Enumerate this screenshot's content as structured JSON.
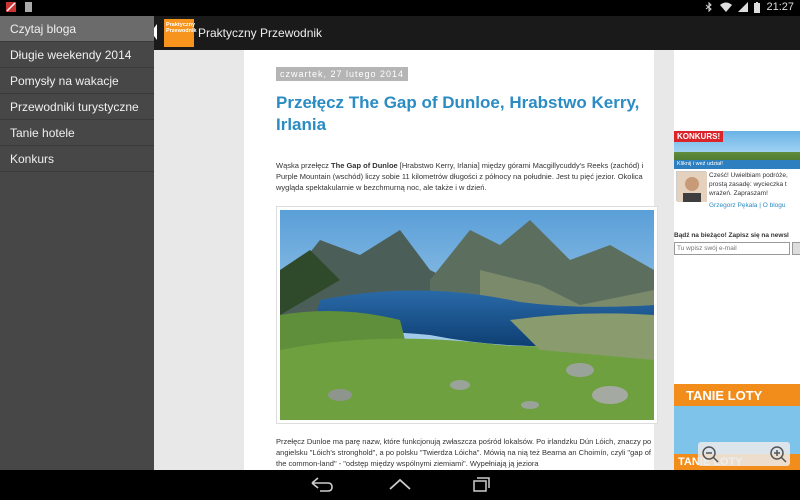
{
  "status_bar": {
    "time": "21:27"
  },
  "action_bar": {
    "title": "Praktyczny Przewodnik",
    "logo_text": "Praktyczny Przewodnik"
  },
  "drawer": {
    "items": [
      {
        "label": "Czytaj bloga"
      },
      {
        "label": "Długie weekendy 2014"
      },
      {
        "label": "Pomysły na wakacje"
      },
      {
        "label": "Przewodniki turystyczne"
      },
      {
        "label": "Tanie hotele"
      },
      {
        "label": "Konkurs"
      }
    ]
  },
  "post": {
    "date": "czwartek, 27 lutego 2014",
    "title": "Przełęcz The Gap of Dunloe, Hrabstwo Kerry, Irlania",
    "intro_before": "Wąska przełęcz ",
    "intro_bold": "The Gap of Dunloe",
    "intro_after": " [Hrabstwo Kerry, Irlania] między górami Macgillycuddy's Reeks (zachód) i Purple Mountain (wschód) liczy sobie 11 kilometrów długości z północy na południe. Jest tu pięć jezior. Okolica wygląda spektakularnie w bezchmurną noc, ale także i w dzień.",
    "body": "Przełęcz Dunloe ma parę nazw, które funkcjonują zwłaszcza pośród lokalsów. Po irlandzku Dún Lóich, znaczy po angielsku \"Lóich's stronghold\", a po polsku \"Twierdza Lóicha\". Mówią na nią też Bearna an Choimín, czyli \"gap of the common-land\" - \"odstęp między wspólnymi ziemiami\". Wypełniają ją jeziora"
  },
  "sidebar": {
    "konkurs_tag": "KONKURS!",
    "konkurs_strip": "Kliknij i weź udział!",
    "author_lines": [
      "Cześć! Uwielbiam podróże,",
      "prostą zasadę: wycieczka t",
      "wrażeń. Zapraszam!"
    ],
    "author_link": "Grzegorz Pękala | O blogu",
    "newsletter_title": "Bądź na bieżąco! Zapisz się na newsl",
    "email_placeholder": "Tu wpisz swój e-mail",
    "tanie_loty": "TANIE LOTY",
    "tanie_loty_sub": "TANIE LOTY"
  },
  "colors": {
    "accent": "#2b8cc4",
    "brand": "#f7941d",
    "drawer_bg": "#474747"
  }
}
